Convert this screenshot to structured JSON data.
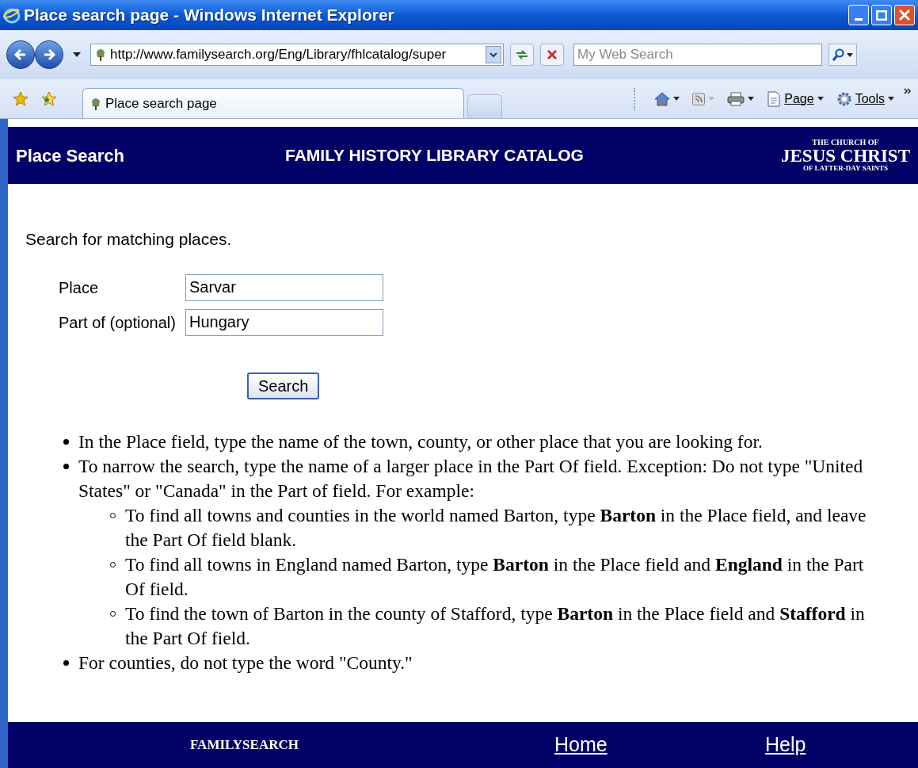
{
  "window": {
    "title": "Place search page - Windows Internet Explorer"
  },
  "address_bar": {
    "url": "http://www.familysearch.org/Eng/Library/fhlcatalog/super"
  },
  "search_box": {
    "placeholder": "My Web Search"
  },
  "tabs": [
    {
      "label": "Place search page",
      "selected": true
    }
  ],
  "command_bar": [
    {
      "kind": "home"
    },
    {
      "kind": "feeds"
    },
    {
      "kind": "print"
    },
    {
      "kind": "page",
      "label": "Page"
    },
    {
      "kind": "tools",
      "label": "Tools"
    }
  ],
  "header": {
    "section": "Place Search",
    "title": "FAMILY HISTORY LIBRARY CATALOG",
    "logo": [
      "THE CHURCH OF",
      "JESUS CHRIST",
      "OF LATTER-DAY SAINTS"
    ]
  },
  "intro": "Search for matching places.",
  "form": {
    "fields": [
      {
        "label": "Place",
        "value": "Sarvar"
      },
      {
        "label": "Part of (optional)",
        "value": "Hungary"
      }
    ],
    "button": "Search"
  },
  "instructions": [
    {
      "text": "In the Place field, type the name of the town, county, or other place that you are looking for."
    },
    {
      "text": "To narrow the search, type the name of a larger place in the Part Of field. Exception: Do not type \"United States\" or \"Canada\" in the Part of field. For example:",
      "children": [
        {
          "text": "To find all towns and counties in the world named Barton, type **Barton** in the Place field, and leave the Part Of field blank."
        },
        {
          "text": "To find all towns in England named Barton, type **Barton** in the Place field and **England** in the Part Of field."
        },
        {
          "text": "To find the town of Barton in the county of Stafford, type **Barton** in the Place field and **Stafford** in the Part Of field."
        }
      ]
    },
    {
      "text": "For counties, do not type the word \"County.\""
    }
  ],
  "footer": {
    "logo": "FAMILYSEARCH",
    "links": [
      "Home",
      "Help"
    ]
  }
}
